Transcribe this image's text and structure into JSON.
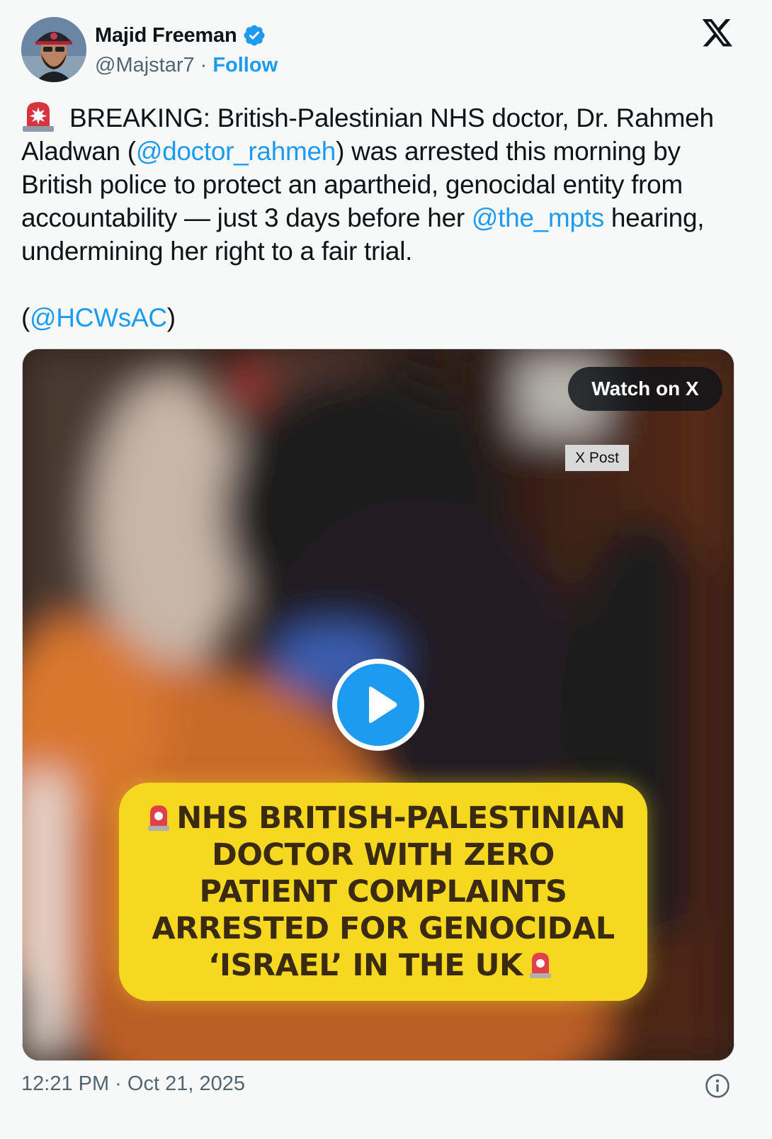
{
  "author": {
    "display_name": "Majid Freeman",
    "handle": "@Majstar7",
    "separator": "·",
    "follow_label": "Follow",
    "verified": true
  },
  "tweet": {
    "line1_text": " BREAKING: British-Palestinian NHS doctor, Dr. Rahmeh Aladwan (",
    "mention1": "@doctor_rahmeh",
    "line1_rest": ") was arrested this morning by British police to protect an apartheid, genocidal entity from accountability — just 3 days before her ",
    "mention2": "@the_mpts",
    "line1_end": " hearing, undermining her right to a fair trial.",
    "para2_open": "(",
    "mention3": "@HCWsAC",
    "para2_close": ")"
  },
  "media": {
    "watch_label": "Watch on X",
    "tag_label": "X Post",
    "caption_lines": [
      "NHS BRITISH-PALESTINIAN",
      "DOCTOR WITH ZERO",
      "PATIENT COMPLAINTS",
      "ARRESTED FOR GENOCIDAL",
      "‘ISRAEL’ IN THE UK"
    ]
  },
  "footer": {
    "timestamp": "12:21 PM · Oct 21, 2025"
  },
  "colors": {
    "accent": "#1d9bf0",
    "secondary_text": "#536471",
    "background": "#f7f9f9",
    "caption_bg": "#f5d81f"
  },
  "icons": [
    "verified-badge-icon",
    "x-logo-icon",
    "siren-icon",
    "play-icon",
    "info-icon"
  ]
}
